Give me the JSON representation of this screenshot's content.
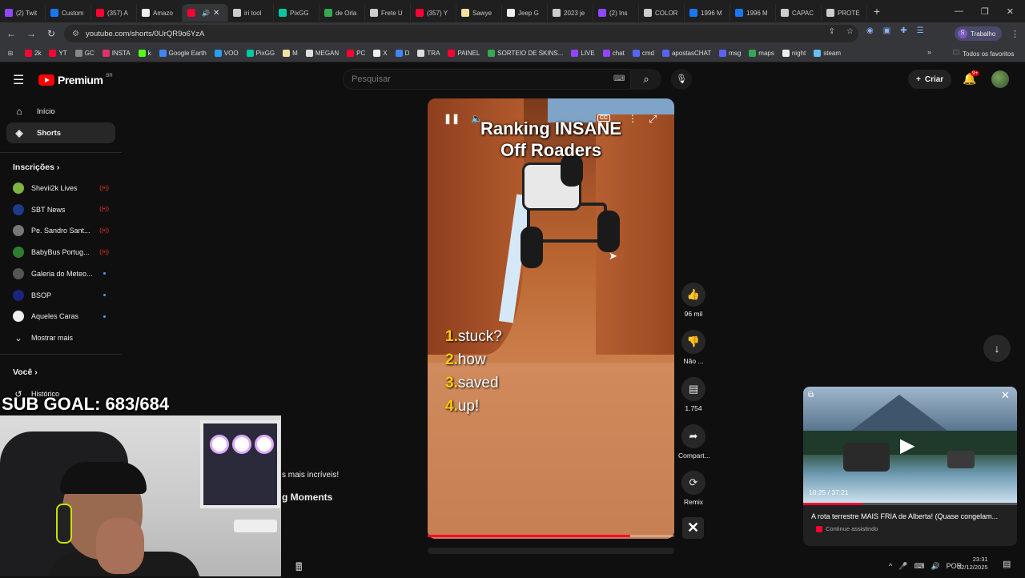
{
  "browser": {
    "tabs": [
      {
        "label": "(2) Twit",
        "color": "#9146ff"
      },
      {
        "label": "Custom",
        "color": "#1877f2"
      },
      {
        "label": "(357) A",
        "color": "#ff0033"
      },
      {
        "label": "Amazo",
        "color": "#eeeeee"
      },
      {
        "label": "",
        "color": "#ff0033",
        "active": true
      },
      {
        "label": "iri tool",
        "color": "#cccccc"
      },
      {
        "label": "PixGG",
        "color": "#00c8a0"
      },
      {
        "label": "de Orla",
        "color": "#34a853"
      },
      {
        "label": "Frete U",
        "color": "#cccccc"
      },
      {
        "label": "(357) Y",
        "color": "#ff0033"
      },
      {
        "label": "Sawye",
        "color": "#f2e0a0"
      },
      {
        "label": "Jeep G",
        "color": "#eeeeee"
      },
      {
        "label": "2023 je",
        "color": "#cccccc"
      },
      {
        "label": "(2) Ins",
        "color": "#9146ff"
      },
      {
        "label": "COLOR",
        "color": "#cccccc"
      },
      {
        "label": "1996 M",
        "color": "#1877f2"
      },
      {
        "label": "1996 M",
        "color": "#1877f2"
      },
      {
        "label": "CAPAC",
        "color": "#cccccc"
      },
      {
        "label": "PROTE",
        "color": "#cccccc"
      }
    ],
    "url": "youtube.com/shorts/0UrQR9o6YzA",
    "profile_label": "Trabalho",
    "profile_initial": "S",
    "bookmarks": [
      {
        "label": "2k",
        "color": "#ff0033"
      },
      {
        "label": "YT",
        "color": "#ff0033"
      },
      {
        "label": "GC",
        "color": "#888888"
      },
      {
        "label": "INSTA",
        "color": "#e1306c"
      },
      {
        "label": "k",
        "color": "#53fc18"
      },
      {
        "label": "Google Earth",
        "color": "#4285f4"
      },
      {
        "label": "VOO",
        "color": "#2a9df4"
      },
      {
        "label": "PixGG",
        "color": "#00c8a0"
      },
      {
        "label": "M",
        "color": "#f2e0a0"
      },
      {
        "label": "MEGAN",
        "color": "#dddddd"
      },
      {
        "label": "PC",
        "color": "#ff0033"
      },
      {
        "label": "X",
        "color": "#eeeeee"
      },
      {
        "label": "D",
        "color": "#4285f4"
      },
      {
        "label": "TRA",
        "color": "#dddddd"
      },
      {
        "label": "PAINEL",
        "color": "#ff0033"
      },
      {
        "label": "SORTEIO DE SKINS...",
        "color": "#34a853"
      },
      {
        "label": "LIVE",
        "color": "#9146ff"
      },
      {
        "label": "chat",
        "color": "#9146ff"
      },
      {
        "label": "cmd",
        "color": "#5865f2"
      },
      {
        "label": "apostasCHAT",
        "color": "#5865f2"
      },
      {
        "label": "msg",
        "color": "#5865f2"
      },
      {
        "label": "maps",
        "color": "#34a853"
      },
      {
        "label": "night",
        "color": "#eeeeee"
      },
      {
        "label": "steam",
        "color": "#66c0f4"
      }
    ],
    "all_bookmarks_label": "Todos os favoritos"
  },
  "youtube": {
    "logo_text": "Premium",
    "logo_sup": "BR",
    "search_placeholder": "Pesquisar",
    "create_label": "Criar",
    "notif_badge": "9+",
    "sidebar": {
      "items": [
        {
          "label": "Início",
          "icon": "home-icon",
          "glyph": "⌂"
        },
        {
          "label": "Shorts",
          "icon": "shorts-icon",
          "glyph": "◈",
          "active": true
        }
      ],
      "subs_heading": "Inscrições",
      "subs": [
        {
          "label": "Shevii2k Lives",
          "color": "#7cb342",
          "status": "live"
        },
        {
          "label": "SBT News",
          "color": "#1e3a8a",
          "status": "live"
        },
        {
          "label": "Pe. Sandro Sant...",
          "color": "#777777",
          "status": "live"
        },
        {
          "label": "BabyBus Portug...",
          "color": "#2e7d32",
          "status": "live"
        },
        {
          "label": "Galeria do Meteo...",
          "color": "#555555",
          "status": "new"
        },
        {
          "label": "BSOP",
          "color": "#1a237e",
          "status": "new"
        },
        {
          "label": "Aqueles Caras",
          "color": "#eeeeee",
          "status": "new"
        }
      ],
      "show_more": "Mostrar mais",
      "you_heading": "Você",
      "history_label": "Histórico"
    },
    "short": {
      "title": "Ranking INSANE\nOff Roaders",
      "list": [
        {
          "num": "1.",
          "text": "stuck?"
        },
        {
          "num": "2.",
          "text": "how"
        },
        {
          "num": "3.",
          "text": "saved"
        },
        {
          "num": "4.",
          "text": "up!"
        }
      ],
      "progress": 0.82,
      "actions": {
        "like_count": "96 mil",
        "dislike_label": "Não ...",
        "comment_count": "1.754",
        "share_label": "Compart...",
        "remix_label": "Remix"
      }
    },
    "miniplayer": {
      "time": "10:25 / 37:21",
      "progress": 0.279,
      "title": "A rota terrestre MAIS FRIA de Alberta! (Quase congelam...",
      "subtitle": "Continue assistindo"
    }
  },
  "overlay": {
    "sub_goal": "SUB GOAL: 683/684",
    "peek_line1": "s mais incríveis!",
    "peek_line2": "g Moments"
  },
  "taskbar": {
    "lang": "POR",
    "time": "23:31",
    "date": "22/12/2025"
  }
}
